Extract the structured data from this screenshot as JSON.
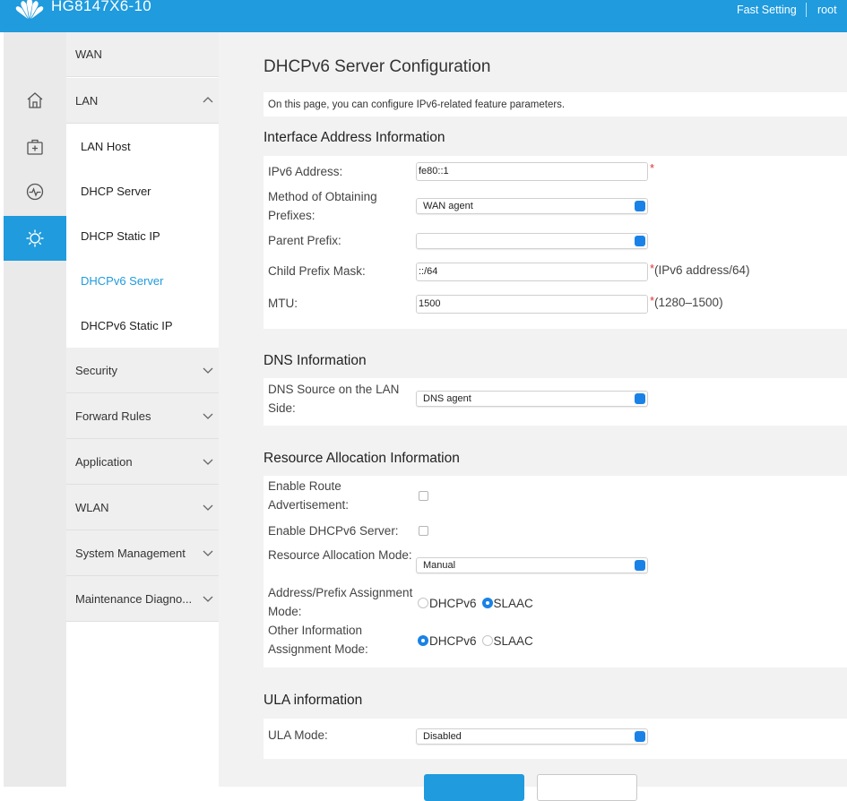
{
  "header": {
    "model": "HG8147X6-10",
    "fast_setting": "Fast Setting",
    "user": "root",
    "brand_color": "#1f9bde"
  },
  "rail": {
    "icons": [
      "home-icon",
      "first-aid-kit-icon",
      "pulse-icon",
      "gear-icon"
    ],
    "active": "gear-icon"
  },
  "menu": {
    "wan": "WAN",
    "lan": "LAN",
    "lan_sub": [
      "LAN Host",
      "DHCP Server",
      "DHCP Static IP",
      "DHCPv6 Server",
      "DHCPv6 Static IP"
    ],
    "active_sub": "DHCPv6 Server",
    "security": "Security",
    "forward_rules": "Forward Rules",
    "application": "Application",
    "wlan": "WLAN",
    "system_management": "System Management",
    "maintenance": "Maintenance Diagno..."
  },
  "page": {
    "title": "DHCPv6 Server Configuration",
    "description": "On this page, you can configure IPv6-related feature parameters."
  },
  "interface": {
    "title": "Interface Address Information",
    "ipv6_label": "IPv6 Address:",
    "ipv6_value": "fe80::1",
    "method_label": "Method of Obtaining Prefixes:",
    "method_value": "WAN agent",
    "parent_label": "Parent Prefix:",
    "parent_value": "",
    "child_label": "Child Prefix Mask:",
    "child_value": "::/64",
    "child_hint": "(IPv6 address/64)",
    "mtu_label": "MTU:",
    "mtu_value": "1500",
    "mtu_hint": "(1280–1500)",
    "required_mark": "*"
  },
  "dns": {
    "title": "DNS Information",
    "source_label": "DNS Source on the LAN Side:",
    "source_value": "DNS agent"
  },
  "resource": {
    "title": "Resource Allocation Information",
    "route_adv_label": "Enable Route Advertisement:",
    "route_adv_checked": false,
    "dhcpv6_server_label": "Enable DHCPv6 Server:",
    "dhcpv6_server_checked": false,
    "mode_label": "Resource Allocation Mode:",
    "mode_value": "Manual",
    "addr_mode_label": "Address/Prefix Assignment Mode:",
    "addr_mode_selected": "SLAAC",
    "other_mode_label": "Other Information Assignment Mode:",
    "other_mode_selected": "DHCPv6",
    "opt_dhcpv6": "DHCPv6",
    "opt_slaac": "SLAAC"
  },
  "ula": {
    "title": "ULA information",
    "mode_label": "ULA Mode:",
    "mode_value": "Disabled"
  },
  "buttons": {
    "primary": "",
    "secondary": ""
  }
}
